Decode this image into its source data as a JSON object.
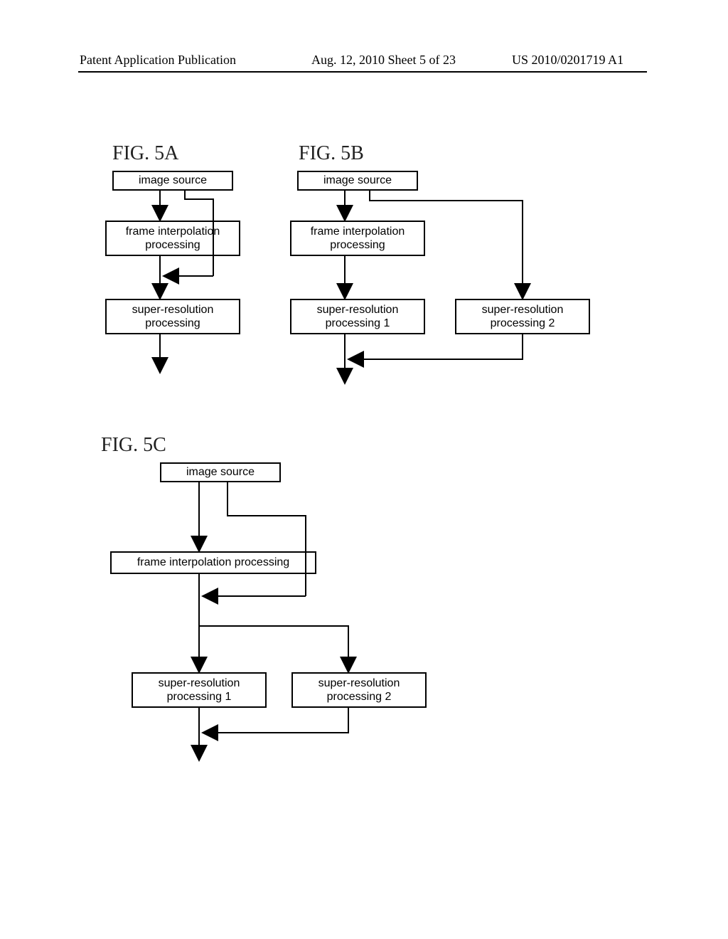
{
  "header": {
    "left": "Patent Application Publication",
    "center": "Aug. 12, 2010  Sheet 5 of 23",
    "right": "US 2010/0201719 A1"
  },
  "labels": {
    "fig5a": "FIG. 5A",
    "fig5b": "FIG. 5B",
    "fig5c": "FIG. 5C"
  },
  "boxes": {
    "image_source": "image source",
    "frame_interp": "frame interpolation\nprocessing",
    "frame_interp_c": "frame interpolation processing",
    "super_res": "super-resolution\nprocessing",
    "super_res1": "super-resolution\nprocessing 1",
    "super_res2": "super-resolution\nprocessing 2"
  }
}
